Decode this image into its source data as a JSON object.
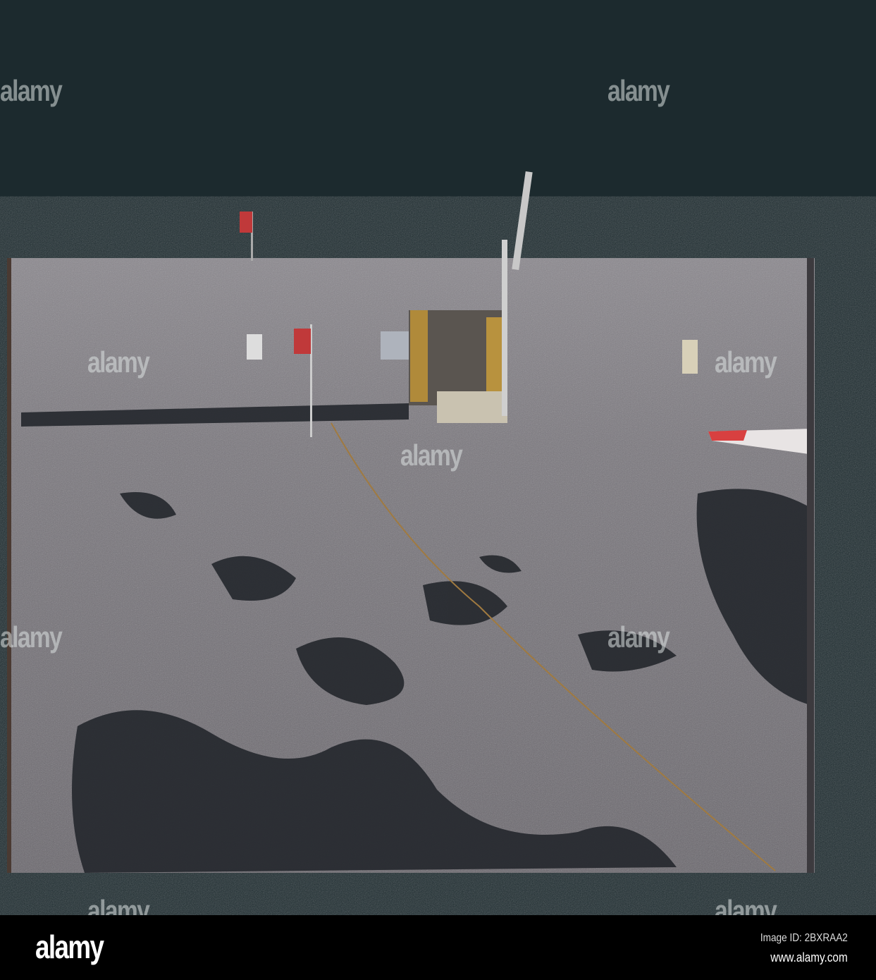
{
  "watermark": {
    "brand": "alamy"
  },
  "footer": {
    "logo": "alamy",
    "image_id": "Image ID: 2BXRAA2",
    "url": "www.alamy.com"
  },
  "colors": {
    "sky": "#1c2a2e",
    "regolith": "#77747a",
    "shadow": "#24272c",
    "flag": "#c0393a"
  }
}
